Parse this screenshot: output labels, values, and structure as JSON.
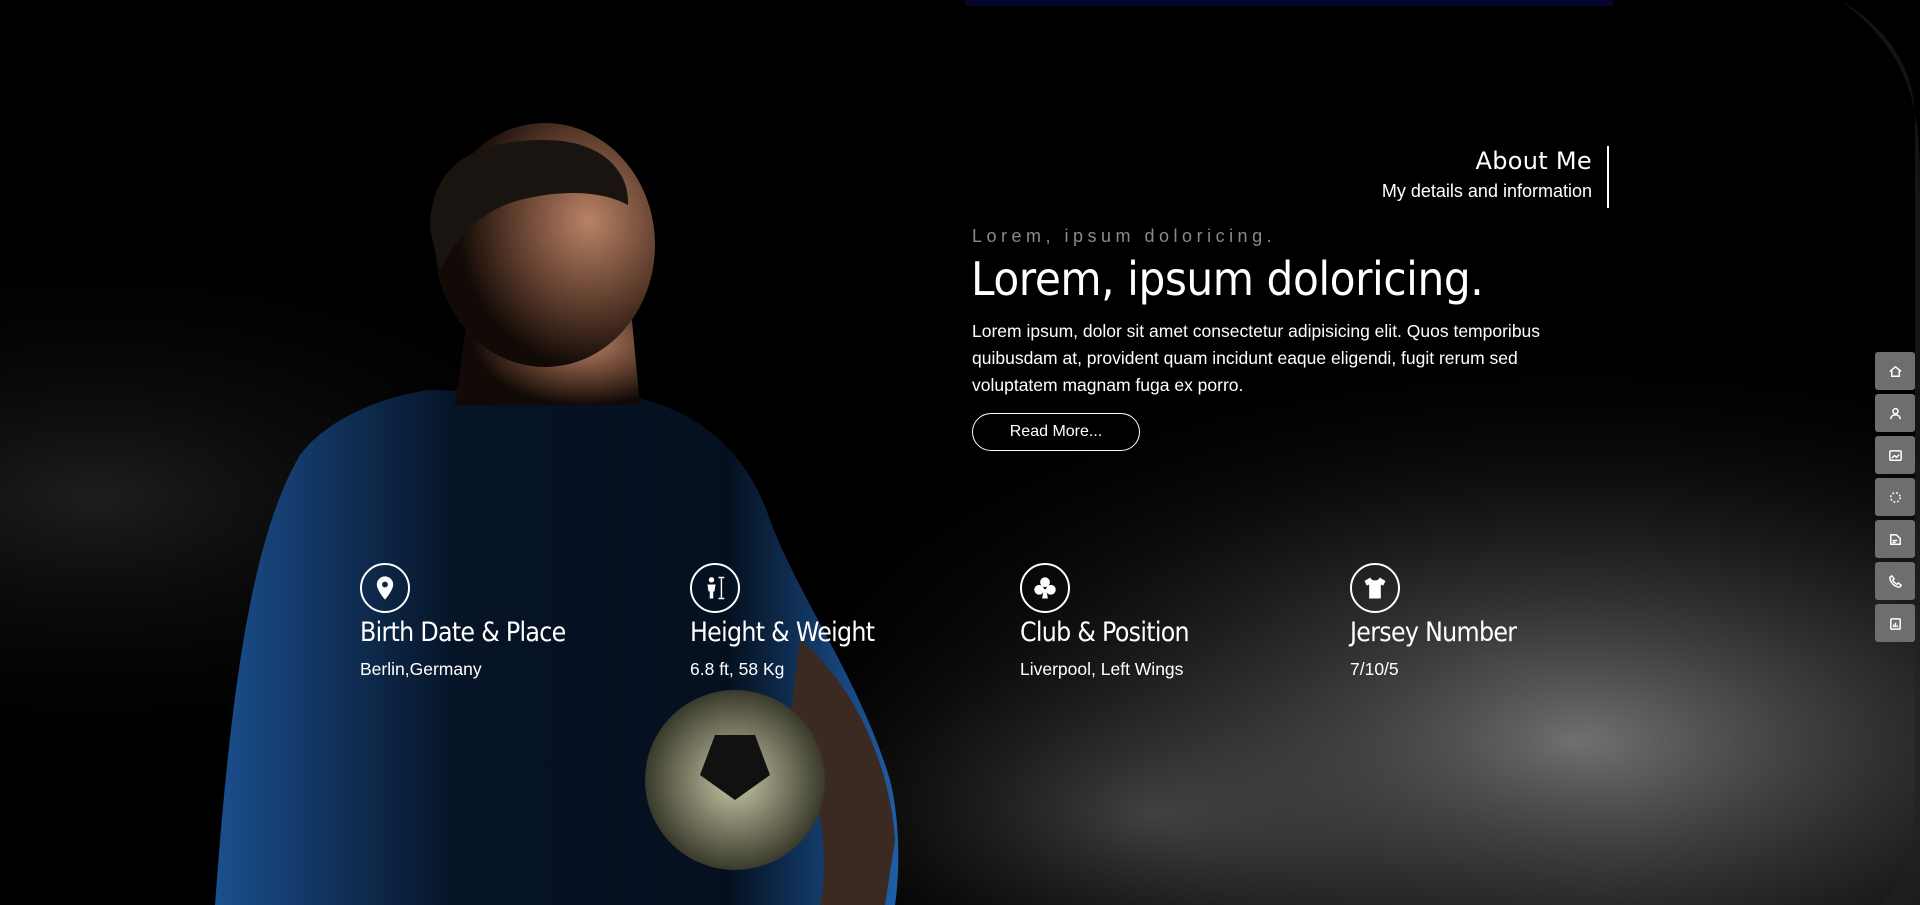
{
  "about": {
    "title": "About Me",
    "subtitle": "My details and information"
  },
  "hero": {
    "eyebrow": "Lorem, ipsum doloricing.",
    "headline": "Lorem, ipsum doloricing.",
    "paragraph": "Lorem ipsum, dolor sit amet consectetur adipisicing elit. Quos temporibus quibusdam at, provident quam incidunt eaque eligendi, fugit rerum sed voluptatem magnam fuga ex porro.",
    "button_label": "Read More..."
  },
  "stats": [
    {
      "icon": "map-pin-icon",
      "title": "Birth Date & Place",
      "value": "Berlin,Germany"
    },
    {
      "icon": "height-weight-icon",
      "title": "Height & Weight",
      "value": "6.8 ft, 58 Kg"
    },
    {
      "icon": "club-icon",
      "title": "Club & Position",
      "value": "Liverpool, Left Wings"
    },
    {
      "icon": "jersey-icon",
      "title": "Jersey Number",
      "value": "7/10/5"
    }
  ],
  "side_nav": [
    "home-icon",
    "user-icon",
    "gallery-icon",
    "loader-icon",
    "blog-icon",
    "phone-icon",
    "clipboard-icon"
  ],
  "colors": {
    "background": "#000000",
    "accent_blue": "#1f5fa8",
    "side_button": "#6e6e6e"
  }
}
